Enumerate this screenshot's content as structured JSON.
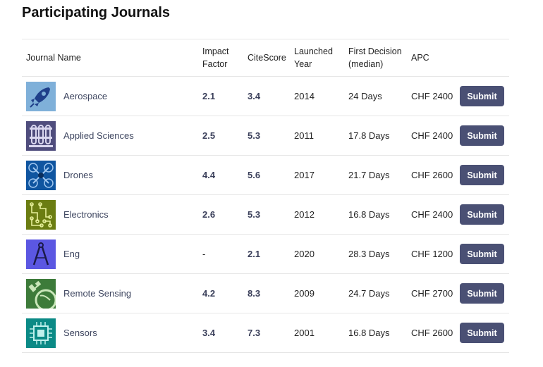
{
  "title": "Participating Journals",
  "headers": {
    "journal_name": "Journal Name",
    "impact_factor": "Impact\nFactor",
    "citescore": "CiteScore",
    "launched_year": "Launched\nYear",
    "first_decision": "First Decision\n(median)",
    "apc": "APC"
  },
  "journals": [
    {
      "name": "Aerospace",
      "icon": "rocket-icon",
      "icon_color": "#7fb0d9",
      "impact_factor": "2.1",
      "citescore": "3.4",
      "launched_year": "2014",
      "first_decision": "24 Days",
      "apc": "CHF 2400",
      "button": "Submit"
    },
    {
      "name": "Applied Sciences",
      "icon": "test-tubes-icon",
      "icon_color": "#4f4d7d",
      "impact_factor": "2.5",
      "citescore": "5.3",
      "launched_year": "2011",
      "first_decision": "17.8 Days",
      "apc": "CHF 2400",
      "button": "Submit"
    },
    {
      "name": "Drones",
      "icon": "drone-icon",
      "icon_color": "#0f55a0",
      "impact_factor": "4.4",
      "citescore": "5.6",
      "launched_year": "2017",
      "first_decision": "21.7 Days",
      "apc": "CHF 2600",
      "button": "Submit"
    },
    {
      "name": "Electronics",
      "icon": "circuit-icon",
      "icon_color": "#6b7d12",
      "impact_factor": "2.6",
      "citescore": "5.3",
      "launched_year": "2012",
      "first_decision": "16.8 Days",
      "apc": "CHF 2400",
      "button": "Submit"
    },
    {
      "name": "Eng",
      "icon": "compass-icon",
      "icon_color": "#5b57e2",
      "impact_factor": "-",
      "citescore": "2.1",
      "launched_year": "2020",
      "first_decision": "28.3 Days",
      "apc": "CHF 1200",
      "button": "Submit"
    },
    {
      "name": "Remote Sensing",
      "icon": "satellite-icon",
      "icon_color": "#3d7b3a",
      "impact_factor": "4.2",
      "citescore": "8.3",
      "launched_year": "2009",
      "first_decision": "24.7 Days",
      "apc": "CHF 2700",
      "button": "Submit"
    },
    {
      "name": "Sensors",
      "icon": "chip-icon",
      "icon_color": "#0b8a86",
      "impact_factor": "3.4",
      "citescore": "7.3",
      "launched_year": "2001",
      "first_decision": "16.8 Days",
      "apc": "CHF 2600",
      "button": "Submit"
    }
  ]
}
